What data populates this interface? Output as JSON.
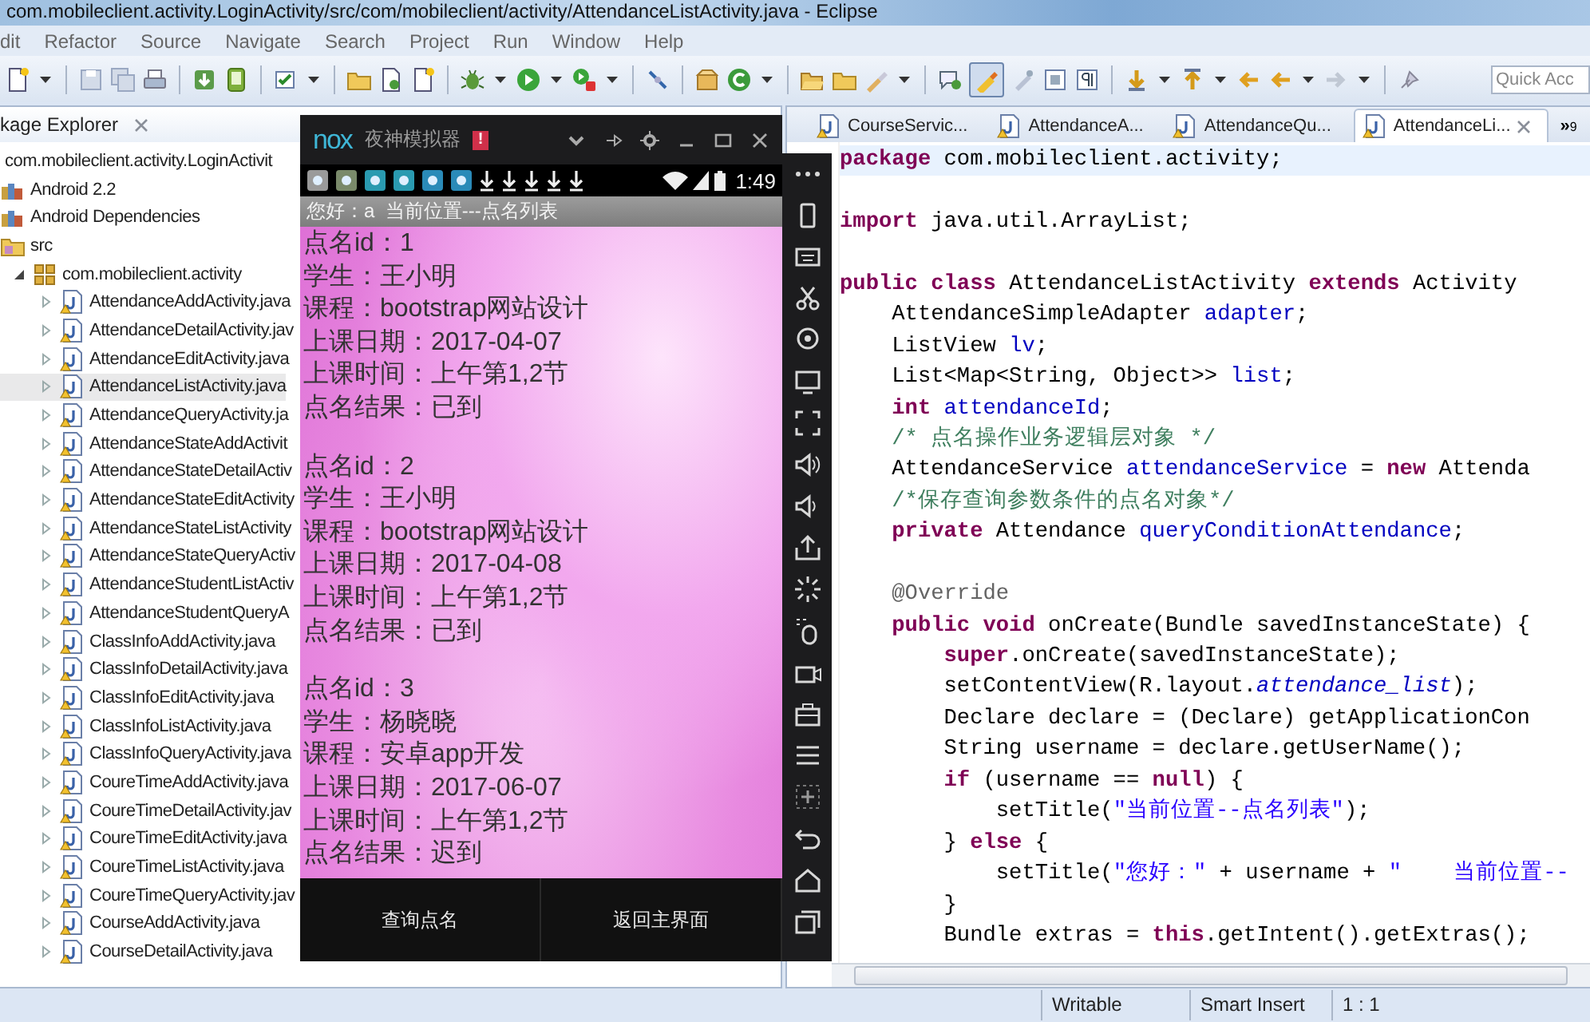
{
  "window": {
    "title": "com.mobileclient.activity.LoginActivity/src/com/mobileclient/activity/AttendanceListActivity.java - Eclipse"
  },
  "menu_bar": [
    "dit",
    "Refactor",
    "Source",
    "Navigate",
    "Search",
    "Project",
    "Run",
    "Window",
    "Help"
  ],
  "toolbar": {
    "toggle_pressed": true,
    "quick_access": {
      "placeholder": "Quick Acc"
    }
  },
  "package_explorer": {
    "title": "kage Explorer",
    "tree": [
      {
        "label": "com.mobileclient.activity.LoginActivit",
        "selected": false,
        "children": [
          {
            "label": "Android 2.2",
            "kind": "library",
            "selected": false
          },
          {
            "label": "Android Dependencies",
            "kind": "library",
            "selected": false
          },
          {
            "label": "src",
            "kind": "source-folder",
            "selected": false,
            "children": [
              {
                "label": "com.mobileclient.activity",
                "kind": "package",
                "expanded": true,
                "selected": false,
                "children": [
                  {
                    "label": "AttendanceAddActivity.java",
                    "kind": "java-file",
                    "expanded": false,
                    "selected": false
                  },
                  {
                    "label": "AttendanceDetailActivity.jav",
                    "kind": "java-file",
                    "expanded": false,
                    "selected": false
                  },
                  {
                    "label": "AttendanceEditActivity.java",
                    "kind": "java-file",
                    "expanded": false,
                    "selected": false
                  },
                  {
                    "label": "AttendanceListActivity.java",
                    "kind": "java-file",
                    "expanded": false,
                    "selected": true
                  },
                  {
                    "label": "AttendanceQueryActivity.ja",
                    "kind": "java-file",
                    "expanded": false,
                    "selected": false
                  },
                  {
                    "label": "AttendanceStateAddActivit",
                    "kind": "java-file",
                    "expanded": false,
                    "selected": false
                  },
                  {
                    "label": "AttendanceStateDetailActiv",
                    "kind": "java-file",
                    "expanded": false,
                    "selected": false
                  },
                  {
                    "label": "AttendanceStateEditActivity",
                    "kind": "java-file",
                    "expanded": false,
                    "selected": false
                  },
                  {
                    "label": "AttendanceStateListActivity",
                    "kind": "java-file",
                    "expanded": false,
                    "selected": false
                  },
                  {
                    "label": "AttendanceStateQueryActiv",
                    "kind": "java-file",
                    "expanded": false,
                    "selected": false
                  },
                  {
                    "label": "AttendanceStudentListActiv",
                    "kind": "java-file",
                    "expanded": false,
                    "selected": false
                  },
                  {
                    "label": "AttendanceStudentQueryA",
                    "kind": "java-file",
                    "expanded": false,
                    "selected": false
                  },
                  {
                    "label": "ClassInfoAddActivity.java",
                    "kind": "java-file",
                    "expanded": false,
                    "selected": false
                  },
                  {
                    "label": "ClassInfoDetailActivity.java",
                    "kind": "java-file",
                    "expanded": false,
                    "selected": false
                  },
                  {
                    "label": "ClassInfoEditActivity.java",
                    "kind": "java-file",
                    "expanded": false,
                    "selected": false
                  },
                  {
                    "label": "ClassInfoListActivity.java",
                    "kind": "java-file",
                    "expanded": false,
                    "selected": false
                  },
                  {
                    "label": "ClassInfoQueryActivity.java",
                    "kind": "java-file",
                    "expanded": false,
                    "selected": false
                  },
                  {
                    "label": "CoureTimeAddActivity.java",
                    "kind": "java-file",
                    "expanded": false,
                    "selected": false
                  },
                  {
                    "label": "CoureTimeDetailActivity.jav",
                    "kind": "java-file",
                    "expanded": false,
                    "selected": false
                  },
                  {
                    "label": "CoureTimeEditActivity.java",
                    "kind": "java-file",
                    "expanded": false,
                    "selected": false
                  },
                  {
                    "label": "CoureTimeListActivity.java",
                    "kind": "java-file",
                    "expanded": false,
                    "selected": false
                  },
                  {
                    "label": "CoureTimeQueryActivity.jav",
                    "kind": "java-file",
                    "expanded": false,
                    "selected": false
                  },
                  {
                    "label": "CourseAddActivity.java",
                    "kind": "java-file",
                    "expanded": false,
                    "selected": false
                  },
                  {
                    "label": "CourseDetailActivity.java",
                    "kind": "java-file",
                    "expanded": false,
                    "selected": false
                  }
                ]
              }
            ]
          }
        ]
      }
    ]
  },
  "editor": {
    "tabs": [
      {
        "label": "CourseServic...",
        "selected": false
      },
      {
        "label": "AttendanceA...",
        "selected": false
      },
      {
        "label": "AttendanceQu...",
        "selected": false
      },
      {
        "label": "AttendanceLi...",
        "selected": true
      }
    ],
    "overflow": {
      "label": "»",
      "count": "9"
    },
    "lines": [
      {
        "current": true,
        "tokens": [
          {
            "kind": "keyword",
            "text": "package"
          },
          {
            "kind": "plain",
            "text": " com.mobileclient.activity;"
          }
        ]
      },
      {
        "current": false,
        "blank_before": true,
        "tokens": [
          {
            "kind": "keyword",
            "text": "import"
          },
          {
            "kind": "plain",
            "text": " java.util.ArrayList;"
          }
        ]
      },
      {
        "current": false,
        "blank_before": true,
        "tokens": [
          {
            "kind": "keyword",
            "text": "public class"
          },
          {
            "kind": "plain",
            "text": " AttendanceListActivity "
          },
          {
            "kind": "keyword",
            "text": "extends"
          },
          {
            "kind": "plain",
            "text": " Activity"
          }
        ]
      },
      {
        "current": false,
        "tokens": [
          {
            "kind": "plain",
            "text": "    AttendanceSimpleAdapter "
          },
          {
            "kind": "field",
            "text": "adapter"
          },
          {
            "kind": "plain",
            "text": ";"
          }
        ]
      },
      {
        "current": false,
        "tokens": [
          {
            "kind": "plain",
            "text": "    ListView "
          },
          {
            "kind": "field",
            "text": "lv"
          },
          {
            "kind": "plain",
            "text": ";"
          }
        ]
      },
      {
        "current": false,
        "tokens": [
          {
            "kind": "plain",
            "text": "    List<Map<String, Object>> "
          },
          {
            "kind": "field",
            "text": "list"
          },
          {
            "kind": "plain",
            "text": ";"
          }
        ]
      },
      {
        "current": false,
        "tokens": [
          {
            "kind": "keyword",
            "text": "    int"
          },
          {
            "kind": "field",
            "text": " attendanceId"
          },
          {
            "kind": "plain",
            "text": ";"
          }
        ]
      },
      {
        "current": false,
        "tokens": [
          {
            "kind": "comment",
            "text": "    /* 点名操作业务逻辑层对象 */"
          }
        ]
      },
      {
        "current": false,
        "tokens": [
          {
            "kind": "plain",
            "text": "    AttendanceService "
          },
          {
            "kind": "field",
            "text": "attendanceService"
          },
          {
            "kind": "plain",
            "text": " = "
          },
          {
            "kind": "keyword",
            "text": "new"
          },
          {
            "kind": "plain",
            "text": " Attenda"
          }
        ]
      },
      {
        "current": false,
        "tokens": [
          {
            "kind": "comment",
            "text": "    /*保存查询参数条件的点名对象*/"
          }
        ]
      },
      {
        "current": false,
        "tokens": [
          {
            "kind": "keyword",
            "text": "    private"
          },
          {
            "kind": "plain",
            "text": " Attendance "
          },
          {
            "kind": "field",
            "text": "queryConditionAttendance"
          },
          {
            "kind": "plain",
            "text": ";"
          }
        ]
      },
      {
        "current": false,
        "blank_before": true,
        "tokens": [
          {
            "kind": "annotation",
            "text": "    @Override"
          }
        ]
      },
      {
        "current": false,
        "tokens": [
          {
            "kind": "keyword",
            "text": "    public void"
          },
          {
            "kind": "plain",
            "text": " onCreate(Bundle savedInstanceState) {"
          }
        ]
      },
      {
        "current": false,
        "tokens": [
          {
            "kind": "keyword",
            "text": "        super"
          },
          {
            "kind": "plain",
            "text": ".onCreate(savedInstanceState);"
          }
        ]
      },
      {
        "current": false,
        "tokens": [
          {
            "kind": "plain",
            "text": "        setContentView(R.layout."
          },
          {
            "kind": "static",
            "text": "attendance_list"
          },
          {
            "kind": "plain",
            "text": ");"
          }
        ]
      },
      {
        "current": false,
        "tokens": [
          {
            "kind": "plain",
            "text": "        Declare declare = (Declare) getApplicationCon"
          }
        ]
      },
      {
        "current": false,
        "tokens": [
          {
            "kind": "plain",
            "text": "        String username = declare.getUserName();"
          }
        ]
      },
      {
        "current": false,
        "tokens": [
          {
            "kind": "keyword",
            "text": "        if"
          },
          {
            "kind": "plain",
            "text": " (username == "
          },
          {
            "kind": "keyword",
            "text": "null"
          },
          {
            "kind": "plain",
            "text": ") {"
          }
        ]
      },
      {
        "current": false,
        "tokens": [
          {
            "kind": "plain",
            "text": "            setTitle("
          },
          {
            "kind": "string",
            "text": "\"当前位置--点名列表\""
          },
          {
            "kind": "plain",
            "text": ");"
          }
        ]
      },
      {
        "current": false,
        "tokens": [
          {
            "kind": "plain",
            "text": "        } "
          },
          {
            "kind": "keyword",
            "text": "else"
          },
          {
            "kind": "plain",
            "text": " {"
          }
        ]
      },
      {
        "current": false,
        "tokens": [
          {
            "kind": "plain",
            "text": "            setTitle("
          },
          {
            "kind": "string",
            "text": "\"您好：\""
          },
          {
            "kind": "plain",
            "text": " + username + "
          },
          {
            "kind": "string",
            "text": "\"    当前位置--"
          }
        ]
      },
      {
        "current": false,
        "tokens": [
          {
            "kind": "plain",
            "text": "        }"
          }
        ]
      },
      {
        "current": false,
        "tokens": [
          {
            "kind": "plain",
            "text": "        Bundle extras = "
          },
          {
            "kind": "keyword",
            "text": "this"
          },
          {
            "kind": "plain",
            "text": ".getIntent().getExtras();"
          }
        ]
      }
    ]
  },
  "emulator": {
    "logo": "nox",
    "title": "夜神模拟器",
    "notice_badge": "!",
    "status_time": "1:49",
    "action_title": "您好：a  当前位置---点名列表",
    "records": [
      {
        "lines": [
          "点名id：1",
          "学生：王小明",
          "课程：bootstrap网站设计",
          "上课日期：2017-04-07",
          "上课时间：上午第1,2节",
          "点名结果：已到"
        ]
      },
      {
        "lines": [
          "点名id：2",
          "学生：王小明",
          "课程：bootstrap网站设计",
          "上课日期：2017-04-08",
          "上课时间：上午第1,2节",
          "点名结果：已到"
        ]
      },
      {
        "lines": [
          "点名id：3",
          "学生：杨晓晓",
          "课程：安卓app开发",
          "上课日期：2017-06-07",
          "上课时间：上午第1,2节",
          "点名结果：迟到"
        ]
      }
    ],
    "buttons": [
      "查询点名",
      "返回主界面"
    ]
  },
  "status_bar": [
    "Writable",
    "Smart Insert",
    "1 : 1"
  ]
}
